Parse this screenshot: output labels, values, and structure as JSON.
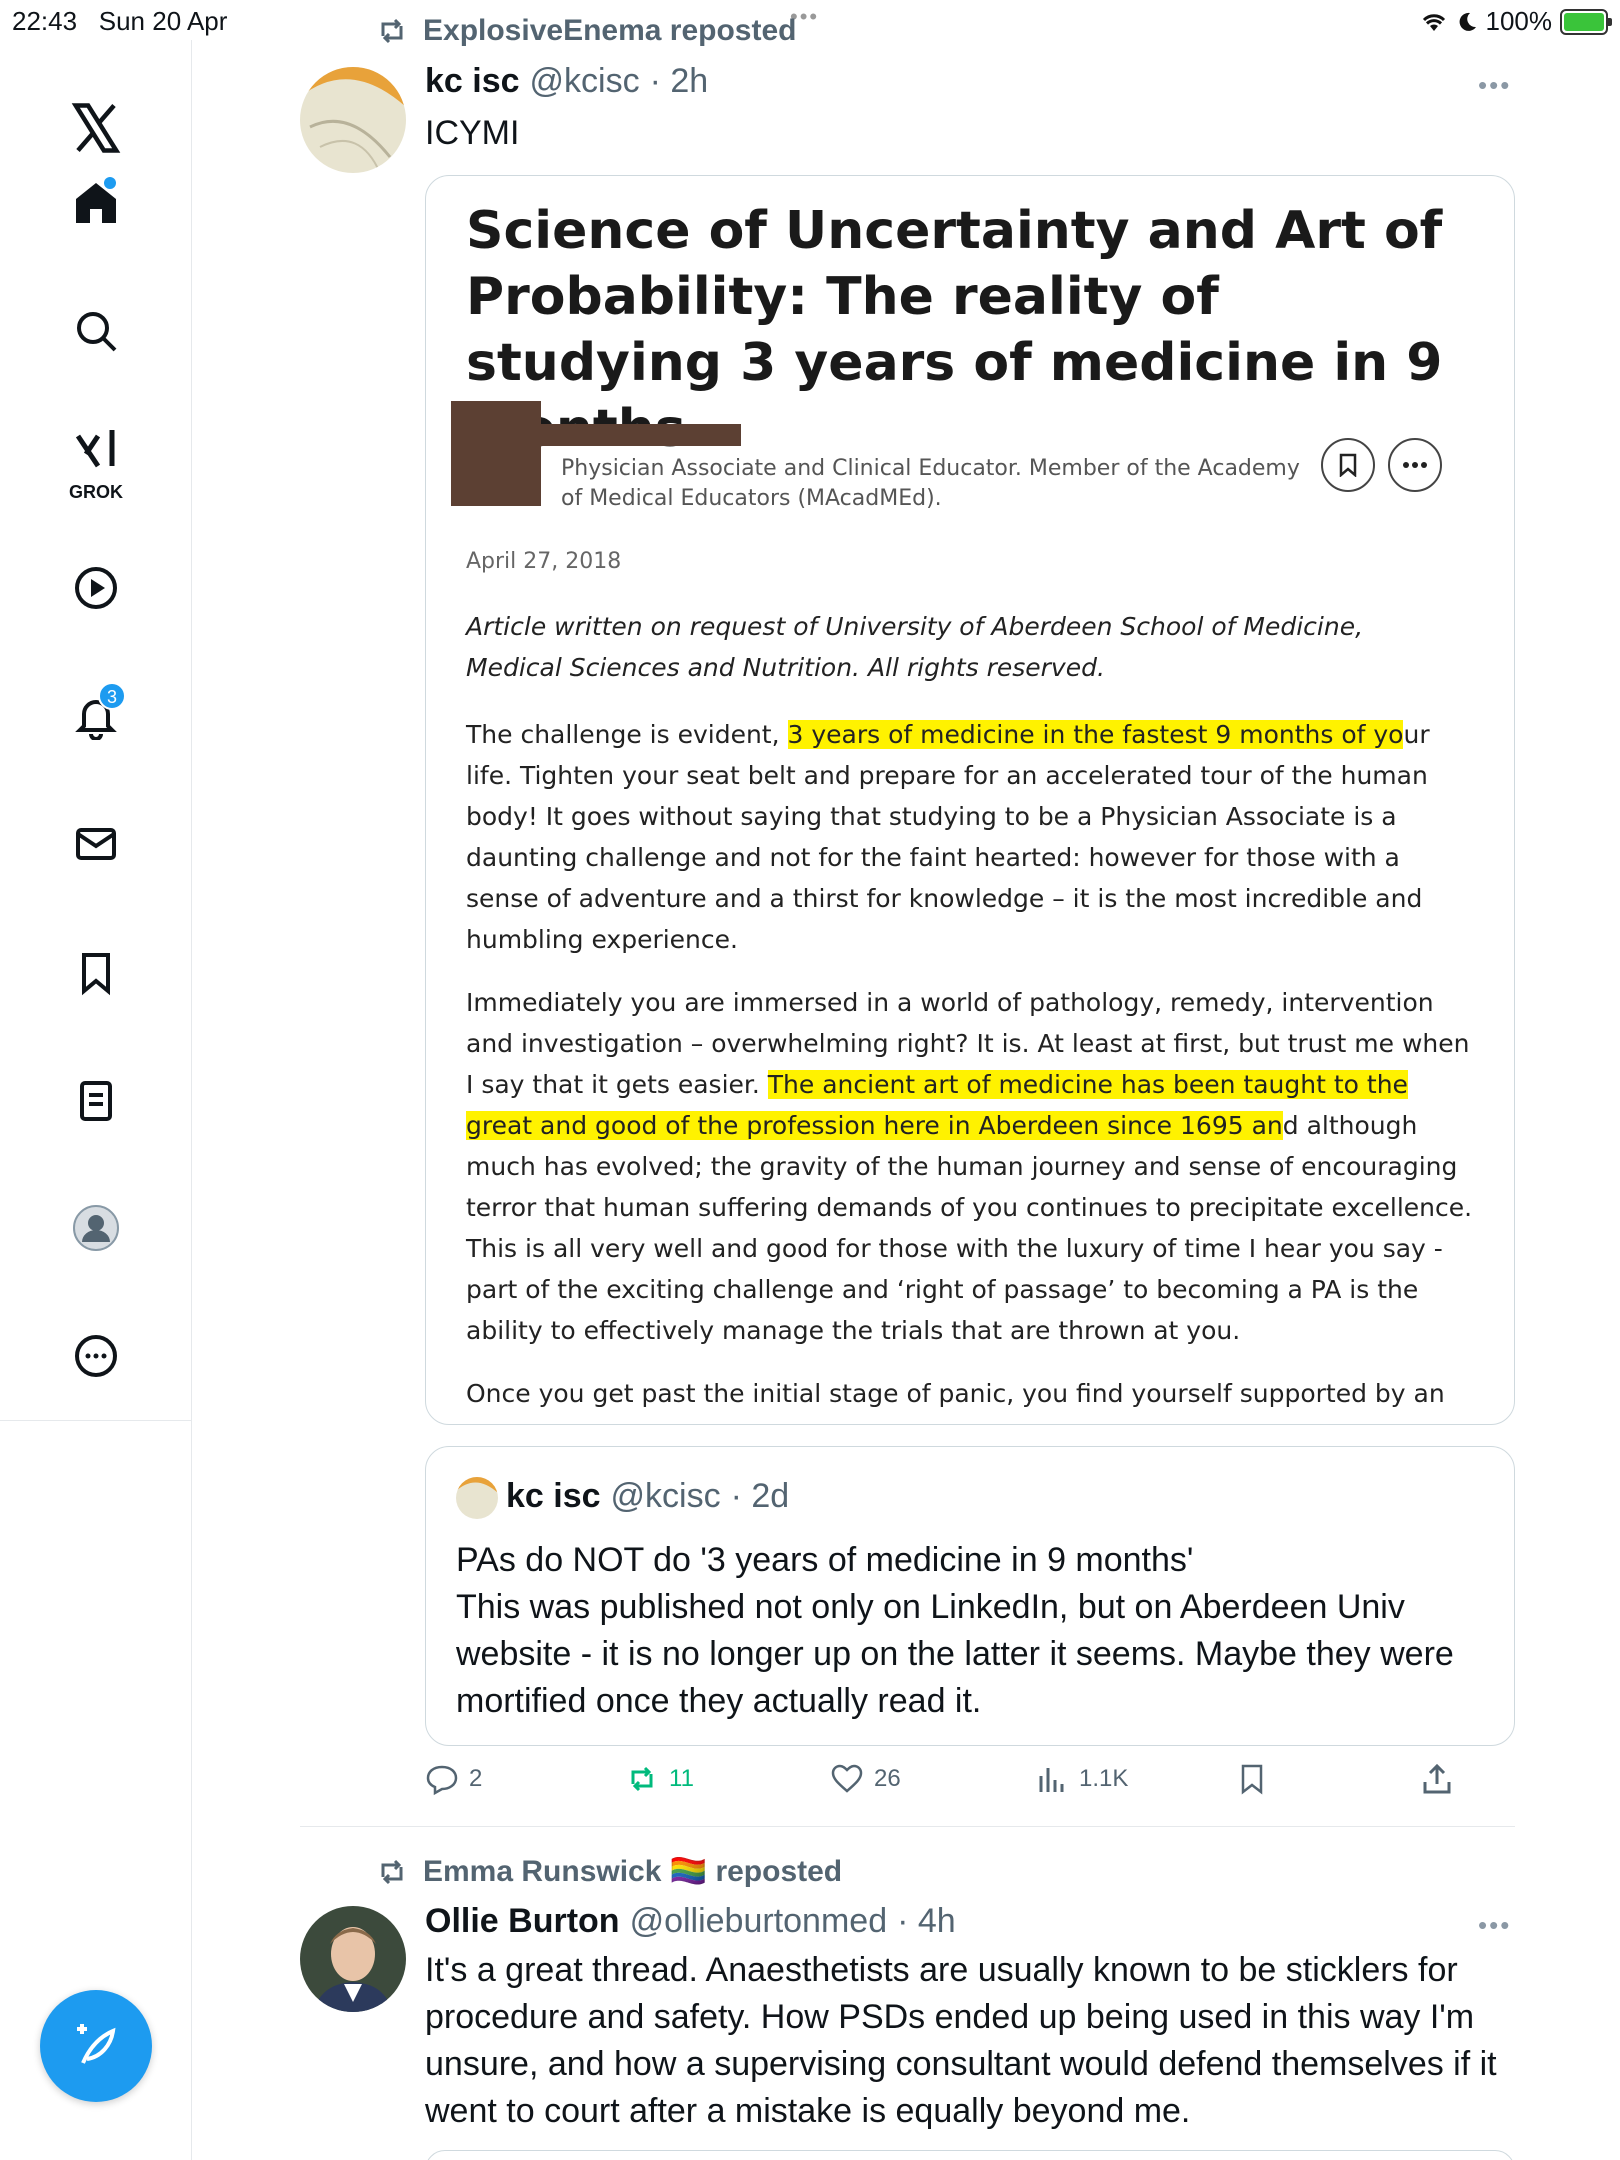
{
  "status_bar": {
    "time": "22:43",
    "date": "Sun 20 Apr",
    "battery": "100%"
  },
  "sidebar": {
    "grok_label": "GROK",
    "notifications_count": "3"
  },
  "tweet1": {
    "reposted_by": "ExplosiveEnema reposted",
    "name": "kc isc",
    "handle": "@kcisc",
    "time": "· 2h",
    "text": "ICYMI",
    "article": {
      "title": "Science of Uncertainty and Art of Probability: The reality of studying 3 years of medicine in 9 months.",
      "author_desc": "Physician Associate and Clinical Educator. Member of the Academy of Medical Educators (MAcadMEd).",
      "date": "April 27, 2018",
      "intro": "Article written on request of University of Aberdeen School of Medicine, Medical Sciences and Nutrition. All rights reserved.",
      "p1_pre": "The challenge is evident, ",
      "p1_hl": "3 years of medicine in the fastest 9 months of yo",
      "p1_post": "ur life.  Tighten your seat belt and prepare for an accelerated tour of the human body!  It goes without saying that studying to be a Physician Associate is a daunting challenge and not for the faint hearted: however for those with a sense of adventure and a thirst for knowledge – it is the most incredible and humbling experience.",
      "p2_pre": "Immediately you are immersed in a world of pathology, remedy, intervention and investigation – overwhelming right? It is. At least at first, but trust me when I say that it gets easier.  ",
      "p2_hl": "The ancient art of medicine has been taught to the great and good of the profession here in Aberdeen since 1695 an",
      "p2_post": "d although much has evolved; the gravity of the human journey and sense of encouraging terror that human suffering demands of you continues to precipitate excellence.  This is all very well and good for those with the luxury of time I hear you say - part of the exciting challenge and ‘right of passage’ to becoming a PA is the ability to effectively manage the trials that are thrown at you.",
      "p3": "Once you get past the initial stage of panic, you find yourself supported by an"
    },
    "quote": {
      "name": "kc isc",
      "handle": "@kcisc",
      "time": "· 2d",
      "text": "PAs do NOT  do '3 years of medicine in 9 months'\nThis was published not only on LinkedIn, but on Aberdeen Univ website - it is no longer up on the latter it seems. Maybe they were mortified once they actually read it."
    },
    "actions": {
      "replies": "2",
      "reposts": "11",
      "likes": "26",
      "views": "1.1K"
    }
  },
  "tweet2": {
    "reposted_by": "Emma Runswick 🏳️‍🌈 reposted",
    "name": "Ollie Burton",
    "handle": "@ollieburtonmed",
    "time": "· 4h",
    "text": "It's a great thread. Anaesthetists are usually known to be sticklers for procedure and safety. How PSDs ended up being used in this way I'm unsure, and how a supervising consultant would defend themselves if it went to court after a mistake is equally beyond me."
  },
  "colors": {
    "accent": "#1d9bf0",
    "repost_green": "#00ba7c",
    "highlight": "#fff200",
    "secondary_text": "#536471"
  }
}
